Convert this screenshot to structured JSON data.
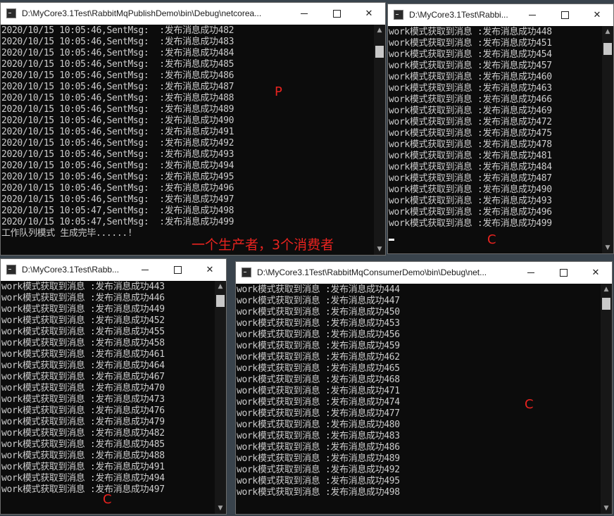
{
  "windows": {
    "publisher": {
      "title": "D:\\MyCore3.1Test\\RabbitMqPublishDemo\\bin\\Debug\\netcorea...",
      "lines": [
        "2020/10/15 10:05:46,SentMsg:  :发布消息成功482",
        "2020/10/15 10:05:46,SentMsg:  :发布消息成功483",
        "2020/10/15 10:05:46,SentMsg:  :发布消息成功484",
        "2020/10/15 10:05:46,SentMsg:  :发布消息成功485",
        "2020/10/15 10:05:46,SentMsg:  :发布消息成功486",
        "2020/10/15 10:05:46,SentMsg:  :发布消息成功487",
        "2020/10/15 10:05:46,SentMsg:  :发布消息成功488",
        "2020/10/15 10:05:46,SentMsg:  :发布消息成功489",
        "2020/10/15 10:05:46,SentMsg:  :发布消息成功490",
        "2020/10/15 10:05:46,SentMsg:  :发布消息成功491",
        "2020/10/15 10:05:46,SentMsg:  :发布消息成功492",
        "2020/10/15 10:05:46,SentMsg:  :发布消息成功493",
        "2020/10/15 10:05:46,SentMsg:  :发布消息成功494",
        "2020/10/15 10:05:46,SentMsg:  :发布消息成功495",
        "2020/10/15 10:05:46,SentMsg:  :发布消息成功496",
        "2020/10/15 10:05:46,SentMsg:  :发布消息成功497",
        "2020/10/15 10:05:47,SentMsg:  :发布消息成功498",
        "2020/10/15 10:05:47,SentMsg:  :发布消息成功499",
        "工作队列模式 生成完毕......!"
      ],
      "annotation": "P",
      "caption": "一个生产者，3个消费者"
    },
    "consumer_top_right": {
      "title": "D:\\MyCore3.1Test\\Rabbi...",
      "lines": [
        "work模式获取到消息 :发布消息成功448",
        "work模式获取到消息 :发布消息成功451",
        "work模式获取到消息 :发布消息成功454",
        "work模式获取到消息 :发布消息成功457",
        "work模式获取到消息 :发布消息成功460",
        "work模式获取到消息 :发布消息成功463",
        "work模式获取到消息 :发布消息成功466",
        "work模式获取到消息 :发布消息成功469",
        "work模式获取到消息 :发布消息成功472",
        "work模式获取到消息 :发布消息成功475",
        "work模式获取到消息 :发布消息成功478",
        "work模式获取到消息 :发布消息成功481",
        "work模式获取到消息 :发布消息成功484",
        "work模式获取到消息 :发布消息成功487",
        "work模式获取到消息 :发布消息成功490",
        "work模式获取到消息 :发布消息成功493",
        "work模式获取到消息 :发布消息成功496",
        "work模式获取到消息 :发布消息成功499"
      ],
      "annotation": "C"
    },
    "consumer_bottom_left": {
      "title": "D:\\MyCore3.1Test\\Rabb...",
      "lines": [
        "work模式获取到消息 :发布消息成功443",
        "work模式获取到消息 :发布消息成功446",
        "work模式获取到消息 :发布消息成功449",
        "work模式获取到消息 :发布消息成功452",
        "work模式获取到消息 :发布消息成功455",
        "work模式获取到消息 :发布消息成功458",
        "work模式获取到消息 :发布消息成功461",
        "work模式获取到消息 :发布消息成功464",
        "work模式获取到消息 :发布消息成功467",
        "work模式获取到消息 :发布消息成功470",
        "work模式获取到消息 :发布消息成功473",
        "work模式获取到消息 :发布消息成功476",
        "work模式获取到消息 :发布消息成功479",
        "work模式获取到消息 :发布消息成功482",
        "work模式获取到消息 :发布消息成功485",
        "work模式获取到消息 :发布消息成功488",
        "work模式获取到消息 :发布消息成功491",
        "work模式获取到消息 :发布消息成功494",
        "work模式获取到消息 :发布消息成功497"
      ],
      "annotation": "C"
    },
    "consumer_bottom_right": {
      "title": "D:\\MyCore3.1Test\\RabbitMqConsumerDemo\\bin\\Debug\\net...",
      "lines": [
        "work模式获取到消息 :发布消息成功444",
        "work模式获取到消息 :发布消息成功447",
        "work模式获取到消息 :发布消息成功450",
        "work模式获取到消息 :发布消息成功453",
        "work模式获取到消息 :发布消息成功456",
        "work模式获取到消息 :发布消息成功459",
        "work模式获取到消息 :发布消息成功462",
        "work模式获取到消息 :发布消息成功465",
        "work模式获取到消息 :发布消息成功468",
        "work模式获取到消息 :发布消息成功471",
        "work模式获取到消息 :发布消息成功474",
        "work模式获取到消息 :发布消息成功477",
        "work模式获取到消息 :发布消息成功480",
        "work模式获取到消息 :发布消息成功483",
        "work模式获取到消息 :发布消息成功486",
        "work模式获取到消息 :发布消息成功489",
        "work模式获取到消息 :发布消息成功492",
        "work模式获取到消息 :发布消息成功495",
        "work模式获取到消息 :发布消息成功498"
      ],
      "annotation": "C"
    }
  },
  "icons": {
    "minimize": "minimize-icon",
    "maximize": "maximize-icon",
    "close": "close-icon",
    "console": "console-app-icon"
  },
  "colors": {
    "console_bg": "#0c0c0c",
    "console_text": "#cccccc",
    "annotation": "#e8231f",
    "titlebar_bg": "#ffffff"
  }
}
